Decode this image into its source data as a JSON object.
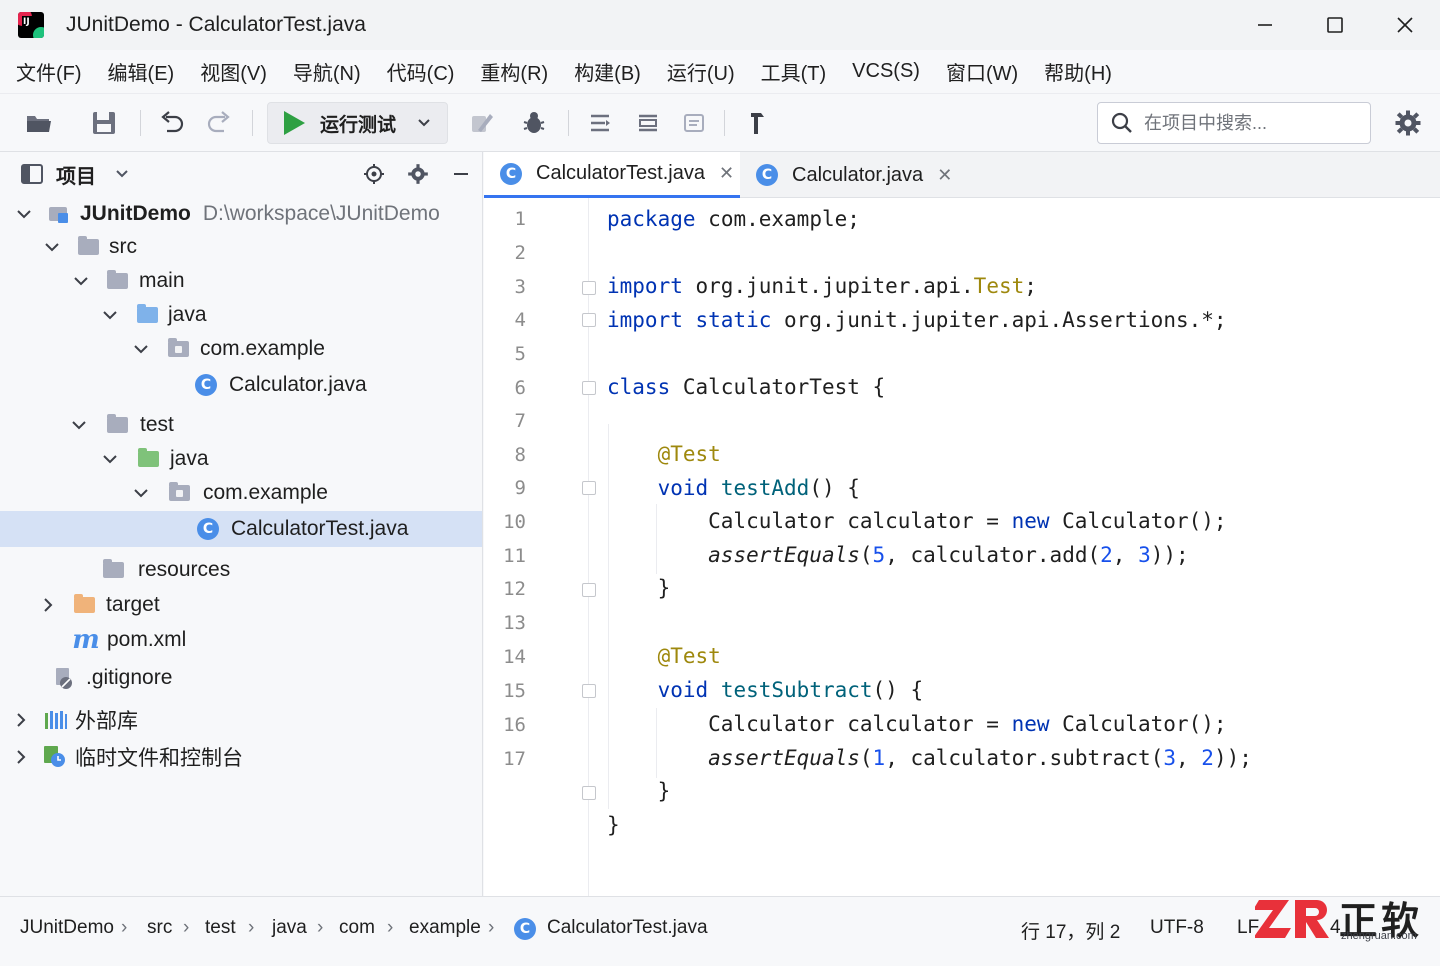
{
  "window": {
    "title": "JUnitDemo  -  CalculatorTest.java"
  },
  "menu": [
    "文件(F)",
    "编辑(E)",
    "视图(V)",
    "导航(N)",
    "代码(C)",
    "重构(R)",
    "构建(B)",
    "运行(U)",
    "工具(T)",
    "VCS(S)",
    "窗口(W)",
    "帮助(H)"
  ],
  "toolbar": {
    "run_config": "运行测试",
    "search_placeholder": "在项目中搜索..."
  },
  "project_panel": {
    "title": "项目",
    "tree": [
      {
        "label": "JUnitDemo",
        "path": "D:\\workspace\\JUnitDemo",
        "icon": "module-icon",
        "expanded": true
      },
      {
        "label": "src",
        "icon": "folder-icon",
        "expanded": true
      },
      {
        "label": "main",
        "icon": "folder-icon",
        "expanded": true
      },
      {
        "label": "java",
        "icon": "source-folder-icon",
        "expanded": true
      },
      {
        "label": "com.example",
        "icon": "package-icon",
        "expanded": true
      },
      {
        "label": "Calculator.java",
        "icon": "java-class-icon"
      },
      {
        "label": "test",
        "icon": "folder-icon",
        "expanded": true
      },
      {
        "label": "java",
        "icon": "test-folder-icon",
        "expanded": true
      },
      {
        "label": "com.example",
        "icon": "package-icon",
        "expanded": true
      },
      {
        "label": "CalculatorTest.java",
        "icon": "java-class-icon",
        "selected": true
      },
      {
        "label": "resources",
        "icon": "folder-icon"
      },
      {
        "label": "target",
        "icon": "excluded-folder-icon",
        "expanded": false
      },
      {
        "label": "pom.xml",
        "icon": "maven-icon"
      },
      {
        "label": ".gitignore",
        "icon": "gitignore-icon"
      },
      {
        "label": "外部库",
        "icon": "library-icon",
        "expanded": false
      },
      {
        "label": "临时文件和控制台",
        "icon": "scratch-icon",
        "expanded": false
      }
    ]
  },
  "tabs": [
    {
      "label": "CalculatorTest.java",
      "active": true
    },
    {
      "label": "Calculator.java",
      "active": false
    }
  ],
  "editor": {
    "line_numbers": [
      "1",
      "2",
      "3",
      "4",
      "5",
      "6",
      "7",
      "8",
      "9",
      "10",
      "11",
      "12",
      "13",
      "14",
      "15",
      "16",
      "17"
    ],
    "code": [
      "package com.example;",
      "",
      "import org.junit.jupiter.api.Test;",
      "import static org.junit.jupiter.api.Assertions.*;",
      "",
      "class CalculatorTest {",
      "",
      "    @Test",
      "    void testAdd() {",
      "        Calculator calculator = new Calculator();",
      "        assertEquals(5, calculator.add(2, 3));",
      "    }",
      "",
      "    @Test",
      "    void testSubtract() {",
      "        Calculator calculator = new Calculator();",
      "        assertEquals(1, calculator.subtract(3, 2));",
      "    }",
      "}"
    ]
  },
  "statusbar": {
    "breadcrumb": [
      "JUnitDemo",
      "src",
      "test",
      "java",
      "com",
      "example",
      "CalculatorTest.java"
    ],
    "position": "行 17，列 2",
    "encoding": "UTF-8",
    "line_separator": "LF",
    "indent": "4"
  },
  "watermark": {
    "brand": "正软",
    "url": "zhengruan.com"
  },
  "colors": {
    "accent": "#3574f0",
    "run_green": "#2ea043",
    "keyword": "#0033b3",
    "annotation": "#9e880d",
    "number": "#1750eb",
    "selection": "#d5e1f5"
  }
}
